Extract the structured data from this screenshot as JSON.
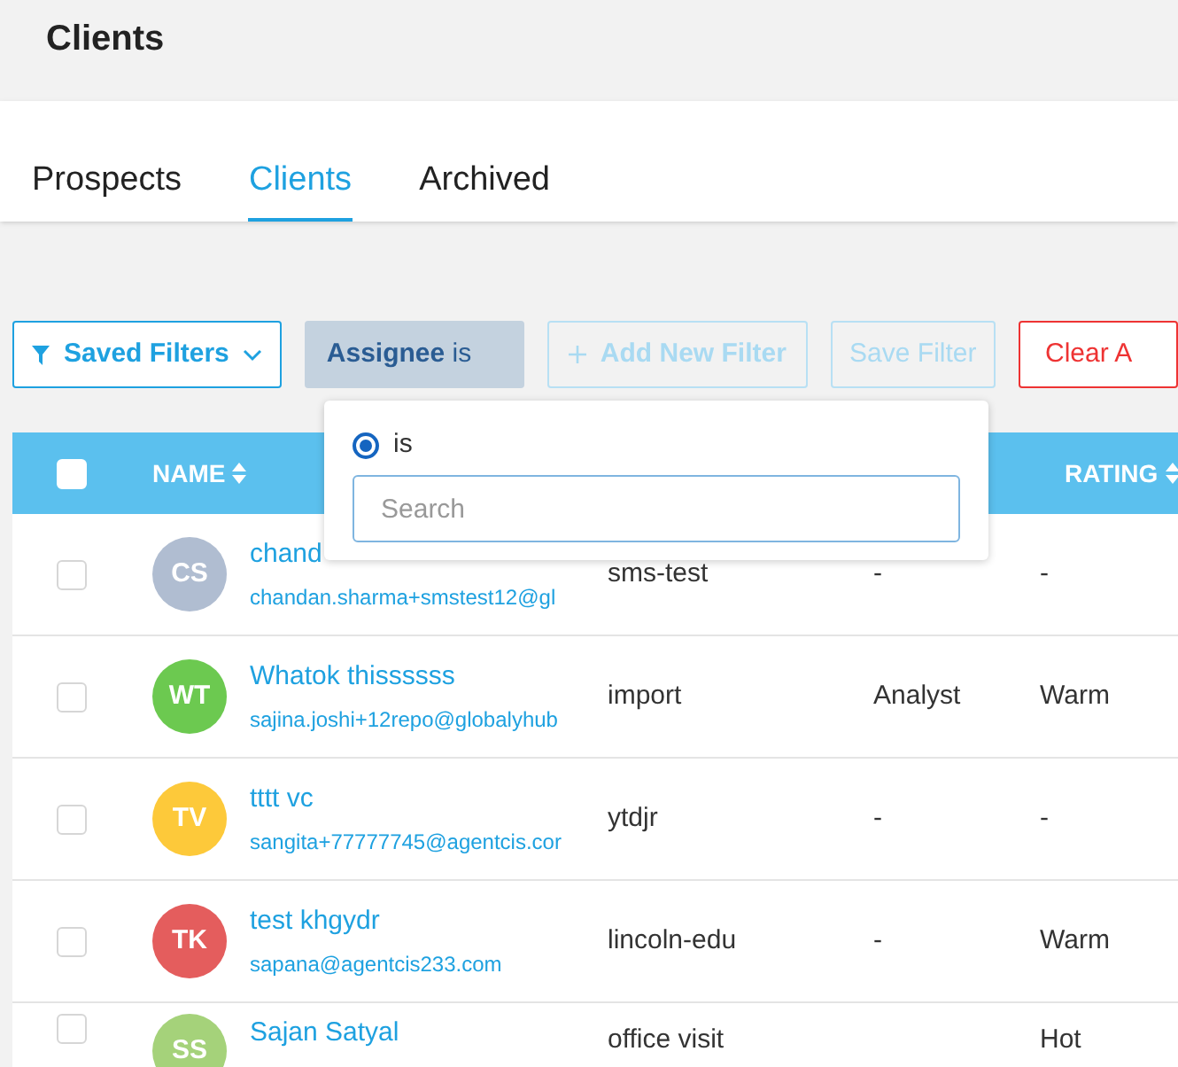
{
  "page_title": "Clients",
  "tabs": [
    {
      "label": "Prospects",
      "selected": false
    },
    {
      "label": "Clients",
      "selected": true
    },
    {
      "label": "Archived",
      "selected": false
    }
  ],
  "toolbar": {
    "saved_filters": "Saved Filters",
    "assignee_filter": {
      "field": "Assignee",
      "operator": "is"
    },
    "add_filter": "Add New Filter",
    "save_filter": "Save Filter",
    "clear": "Clear A"
  },
  "filter_dropdown": {
    "options": [
      {
        "label": "is",
        "selected": true
      }
    ],
    "search": {
      "placeholder": "Search"
    }
  },
  "table": {
    "select_all": {
      "checked": false
    },
    "columns": [
      {
        "label": "NAME",
        "sortable": true
      },
      {
        "label": "RATING",
        "sortable": true
      }
    ],
    "rows": [
      {
        "checked": false,
        "initials": "CS",
        "color": "#b0bdd1",
        "name": "chand",
        "email": "chandan.sharma+smstest12@gl",
        "source": "sms-test",
        "column_4": "-",
        "rating": "-"
      },
      {
        "checked": false,
        "initials": "WT",
        "color": "#6cc950",
        "name": "Whatok thissssss",
        "email": "sajina.joshi+12repo@globalyhub",
        "source": "import",
        "column_4": "Analyst",
        "rating": "Warm"
      },
      {
        "checked": false,
        "initials": "TV",
        "color": "#fdc93a",
        "name": "tttt vc",
        "email": "sangita+77777745@agentcis.cor",
        "source": "ytdjr",
        "column_4": "-",
        "rating": "-"
      },
      {
        "checked": false,
        "initials": "TK",
        "color": "#e45d5d",
        "name": "test khgydr",
        "email": "sapana@agentcis233.com",
        "source": "lincoln-edu",
        "column_4": "-",
        "rating": "Warm"
      },
      {
        "checked": false,
        "initials": "SS",
        "color": "#a5d27a",
        "name": "Sajan Satyal",
        "source": "office visit",
        "rating": "Hot"
      }
    ]
  }
}
